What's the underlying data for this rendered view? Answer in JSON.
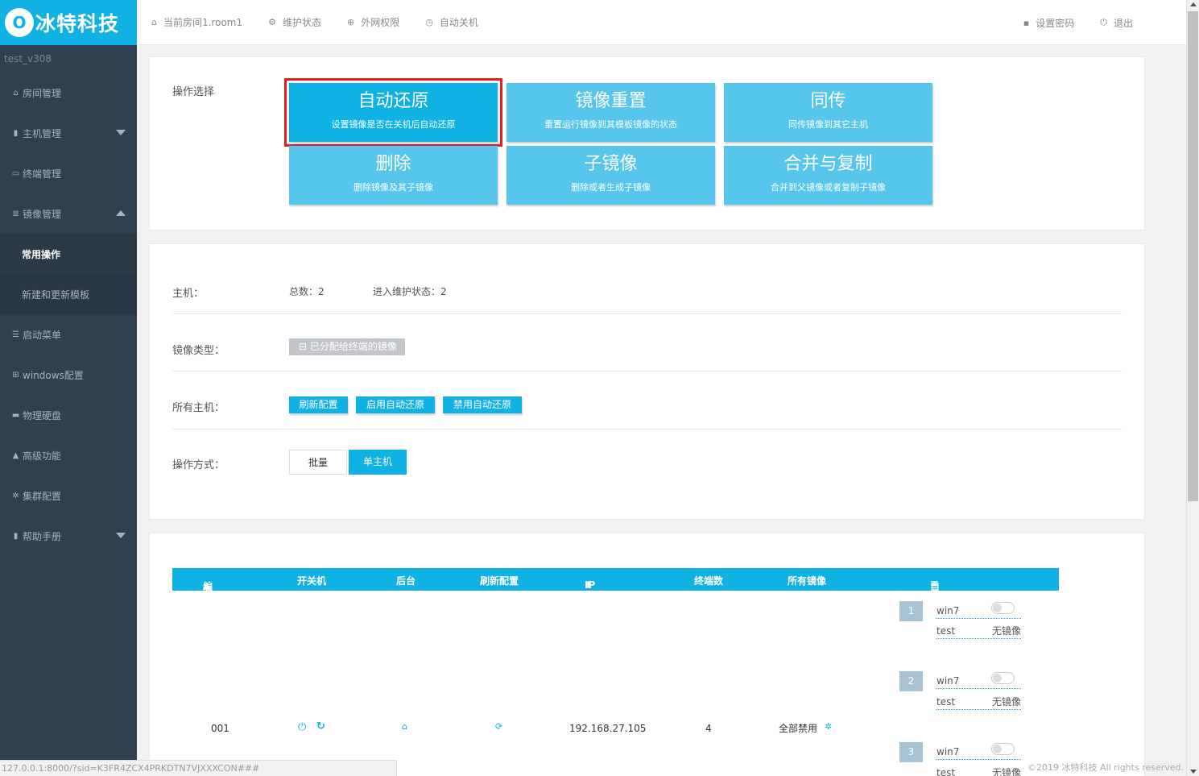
{
  "brand": {
    "mark": "O",
    "name": "冰特科技"
  },
  "version": "test_v308",
  "sidebar": {
    "items": [
      {
        "label": "房间管理",
        "icon": "home-icon"
      },
      {
        "label": "主机管理",
        "icon": "server-icon"
      },
      {
        "label": "终端管理",
        "icon": "monitor-icon"
      },
      {
        "label": "镜像管理",
        "icon": "database-icon"
      },
      {
        "label": "常用操作"
      },
      {
        "label": "新建和更新模板"
      },
      {
        "label": "启动菜单",
        "icon": "list-icon"
      },
      {
        "label": "windows配置",
        "icon": "windows-icon"
      },
      {
        "label": "物理硬盘",
        "icon": "hdd-icon"
      },
      {
        "label": "高级功能",
        "icon": "warning-icon"
      },
      {
        "label": "集群配置",
        "icon": "gear-icon"
      },
      {
        "label": "帮助手册",
        "icon": "book-icon"
      }
    ]
  },
  "topbar": {
    "room": "当前房间1.room1",
    "maintenance": "维护状态",
    "network": "外网权限",
    "shutdown": "自动关机",
    "password": "设置密码",
    "logout": "退出"
  },
  "ops": {
    "label": "操作选择",
    "buttons": [
      {
        "title": "自动还原",
        "desc": "设置镜像是否在关机后自动还原"
      },
      {
        "title": "镜像重置",
        "desc": "重置运行镜像到其模板镜像的状态"
      },
      {
        "title": "同传",
        "desc": "同传镜像到其它主机"
      },
      {
        "title": "删除",
        "desc": "删除镜像及其子镜像"
      },
      {
        "title": "子镜像",
        "desc": "删除或者生成子镜像"
      },
      {
        "title": "合并与复制",
        "desc": "合并到父镜像或者复制子镜像"
      }
    ]
  },
  "host_info": {
    "host_label": "主机：",
    "total": "总数：2",
    "maint": "进入维护状态：2",
    "type_label": "镜像类型：",
    "type_value": "已分配给终端的镜像",
    "all_label": "所有主机：",
    "refresh": "刷新配置",
    "enable": "启用自动还原",
    "disable": "禁用自动还原",
    "mode_label": "操作方式：",
    "batch": "批量",
    "single": "单主机"
  },
  "table": {
    "headers": [
      "编号",
      "开关机",
      "后台",
      "刷新配置",
      "IP地址",
      "终端数",
      "所有镜像",
      "自动还原"
    ],
    "row": {
      "id": "001",
      "ip": "192.168.27.105",
      "terminals": "4",
      "all_images": "全部禁用"
    },
    "images": [
      {
        "num": "1",
        "os": "win7",
        "name": "test",
        "state": "无镜像"
      },
      {
        "num": "2",
        "os": "win7",
        "name": "test",
        "state": "无镜像"
      },
      {
        "num": "3",
        "os": "win7",
        "name": "test",
        "state": "无镜像"
      }
    ]
  },
  "status_url": "127.0.0.1:8000/?sid=K3FR4ZCX4PRKDTN7VJXXXCON###",
  "footer": "©2019 冰特科技 All rights reserved."
}
